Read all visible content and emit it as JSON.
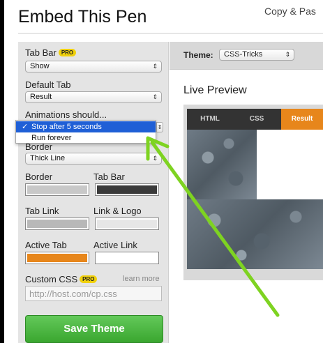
{
  "header": {
    "title": "Embed This Pen",
    "copy_paste": "Copy & Pas"
  },
  "panel": {
    "tab_bar": {
      "label": "Tab Bar",
      "pro": "PRO",
      "value": "Show"
    },
    "default_tab": {
      "label": "Default Tab",
      "value": "Result"
    },
    "animations": {
      "label": "Animations should...",
      "options": [
        "Stop after 5 seconds",
        "Run forever"
      ],
      "selected": "Stop after 5 seconds",
      "check": "✓"
    },
    "border": {
      "label": "Border",
      "value": "Thick Line"
    },
    "colors": {
      "border": {
        "label": "Border",
        "value": "#c8c8c8"
      },
      "tab_bar": {
        "label": "Tab Bar",
        "value": "#3a3a3a"
      },
      "tab_link": {
        "label": "Tab Link",
        "value": "#b8b8b8"
      },
      "link_logo": {
        "label": "Link & Logo",
        "value": "#e6e6e6"
      },
      "active_tab": {
        "label": "Active Tab",
        "value": "#e7861b"
      },
      "active_link": {
        "label": "Active Link",
        "value": "#ffffff"
      }
    },
    "custom_css": {
      "label": "Custom CSS",
      "pro": "PRO",
      "learn_more": "learn more",
      "placeholder": "http://host.com/cp.css"
    },
    "save_button": "Save Theme"
  },
  "theme": {
    "label": "Theme:",
    "value": "CSS-Tricks"
  },
  "preview": {
    "title": "Live Preview",
    "tabs": [
      "HTML",
      "CSS",
      "Result"
    ],
    "active_tab": "Result"
  },
  "colors": {
    "accent_orange": "#e7861b",
    "save_green": "#3aa62f",
    "annotation_arrow": "#7ed321"
  },
  "icons": {
    "select_arrows": "up-down-chevron-icon",
    "checkmark": "checkmark-icon",
    "arrow": "annotation-arrow-icon"
  }
}
